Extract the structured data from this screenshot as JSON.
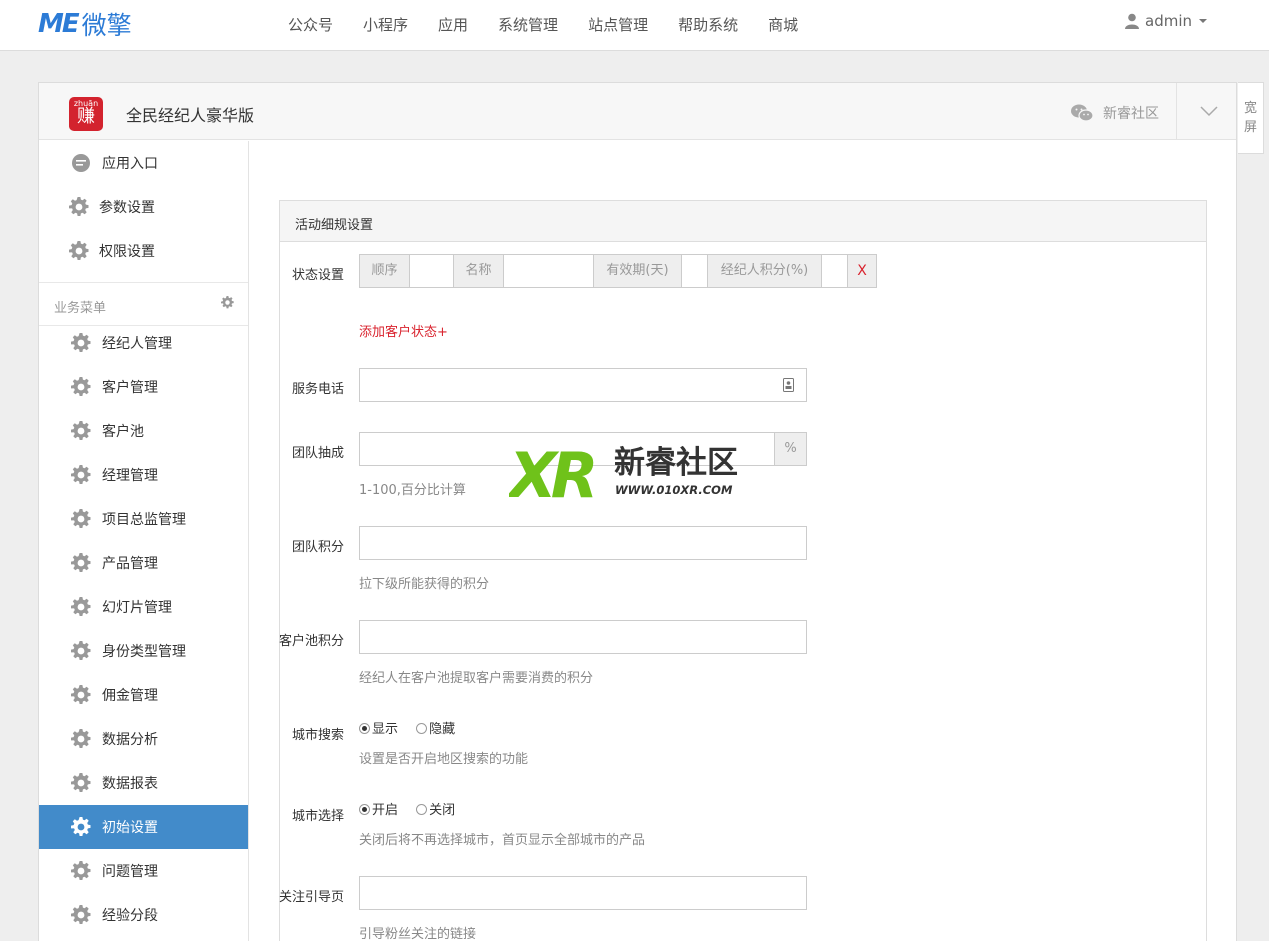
{
  "topbar": {
    "logo_me": "ME",
    "logo_cn": "微擎",
    "nav": [
      "公众号",
      "小程序",
      "应用",
      "系统管理",
      "站点管理",
      "帮助系统",
      "商城"
    ],
    "user": "admin"
  },
  "app": {
    "logo_top": "zhuān",
    "logo_main": "赚",
    "name": "全民经纪人豪华版",
    "community": "新睿社区",
    "wide_label": "宽屏"
  },
  "sidebar": {
    "top_items": [
      "应用入口",
      "参数设置",
      "权限设置"
    ],
    "group_label": "业务菜单",
    "items": [
      "经纪人管理",
      "客户管理",
      "客户池",
      "经理管理",
      "项目总监管理",
      "产品管理",
      "幻灯片管理",
      "身份类型管理",
      "佣金管理",
      "数据分析",
      "数据报表",
      "初始设置",
      "问题管理",
      "经验分段"
    ],
    "active": "初始设置"
  },
  "form": {
    "card_title": "活动细规设置",
    "status_label": "状态设置",
    "status_cols": [
      "顺序",
      "名称",
      "有效期(天)",
      "经纪人积分(%)"
    ],
    "status_delete": "X",
    "add_status": "添加客户状态+",
    "phone_label": "服务电话",
    "phone_value": "",
    "team_commission_label": "团队抽成",
    "team_commission_value": "",
    "team_commission_unit": "%",
    "team_commission_hint": "1-100,百分比计算",
    "team_points_label": "团队积分",
    "team_points_value": "",
    "team_points_hint": "拉下级所能获得的积分",
    "pool_points_label": "客户池积分",
    "pool_points_value": "",
    "pool_points_hint": "经纪人在客户池提取客户需要消费的积分",
    "city_search_label": "城市搜索",
    "city_search_options": [
      "显示",
      "隐藏"
    ],
    "city_search_selected": "显示",
    "city_search_hint": "设置是否开启地区搜索的功能",
    "city_select_label": "城市选择",
    "city_select_options": [
      "开启",
      "关闭"
    ],
    "city_select_selected": "开启",
    "city_select_hint": "关闭后将不再选择城市，首页显示全部城市的产品",
    "follow_label": "关注引导页",
    "follow_value": "",
    "follow_hint": "引导粉丝关注的链接"
  },
  "watermark": {
    "logo": "XR",
    "title": "新睿社区",
    "url": "WWW.010XR.COM"
  },
  "colors": {
    "accent": "#428bca",
    "brand": "#2c7bd6",
    "red": "#d9232e",
    "watermark_green": "#6fc21a"
  }
}
